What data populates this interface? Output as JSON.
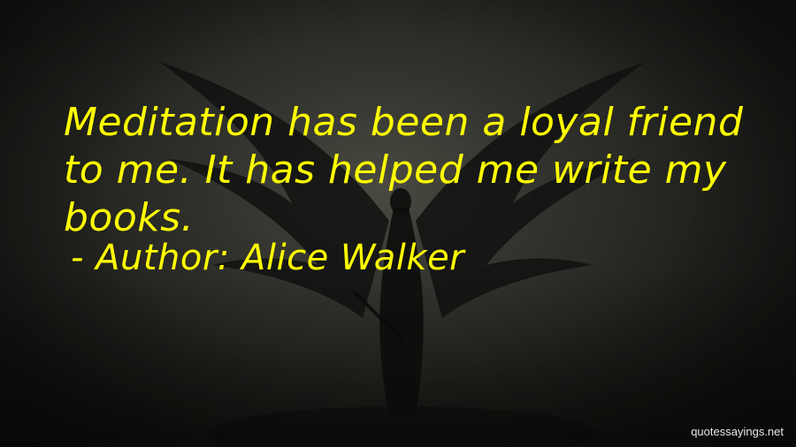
{
  "quote": {
    "text": "Meditation has been a loyal friend to me. It has helped me write my books.",
    "author_line": "- Author: Alice Walker",
    "color": "#ffff00"
  },
  "watermark": {
    "text": "quotessayings.net"
  },
  "background": {
    "description_colors": [
      "#4a4a42",
      "#22221f",
      "#151513"
    ]
  }
}
